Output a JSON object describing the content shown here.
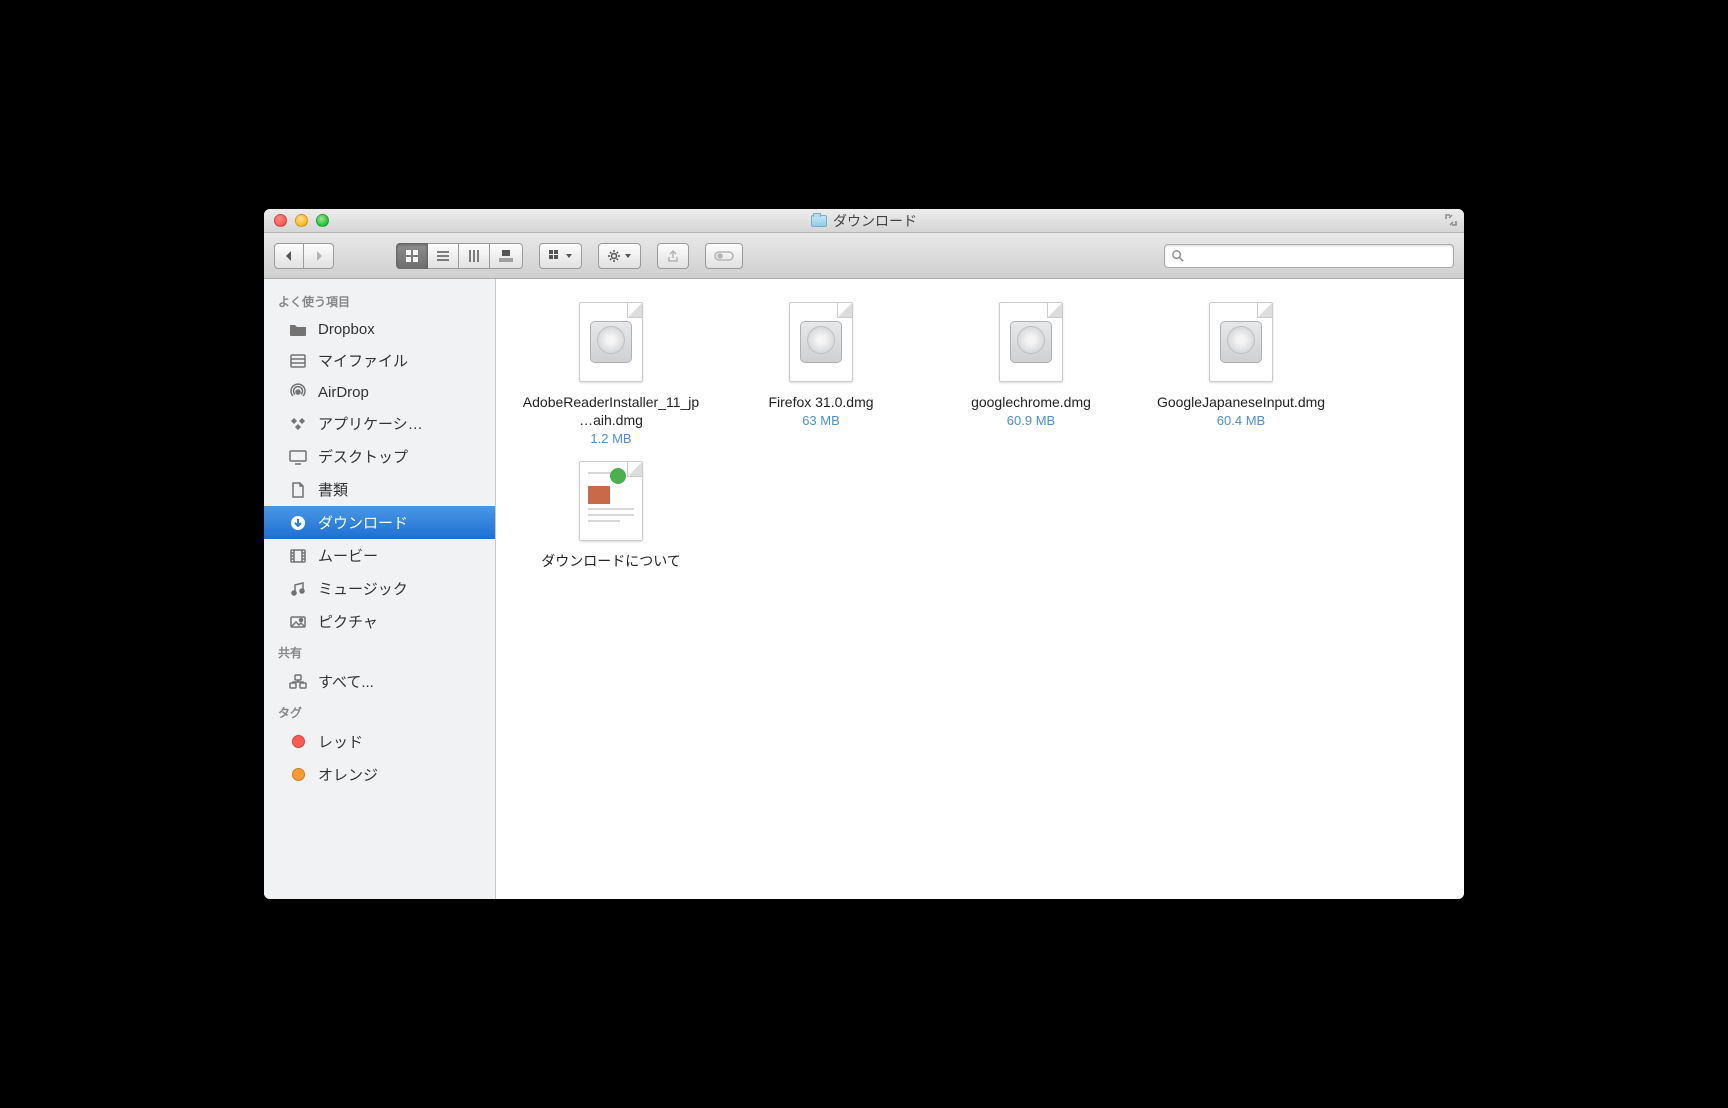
{
  "window": {
    "title": "ダウンロード"
  },
  "search": {
    "placeholder": ""
  },
  "sidebar": {
    "sections": {
      "favorites": {
        "label": "よく使う項目"
      },
      "shared": {
        "label": "共有"
      },
      "tags": {
        "label": "タグ"
      }
    },
    "favorites": [
      {
        "label": "Dropbox",
        "icon": "folder-icon"
      },
      {
        "label": "マイファイル",
        "icon": "all-my-files-icon"
      },
      {
        "label": "AirDrop",
        "icon": "airdrop-icon"
      },
      {
        "label": "アプリケーシ…",
        "icon": "applications-icon"
      },
      {
        "label": "デスクトップ",
        "icon": "desktop-icon"
      },
      {
        "label": "書類",
        "icon": "documents-icon"
      },
      {
        "label": "ダウンロード",
        "icon": "downloads-icon",
        "selected": true
      },
      {
        "label": "ムービー",
        "icon": "movies-icon"
      },
      {
        "label": "ミュージック",
        "icon": "music-icon"
      },
      {
        "label": "ピクチャ",
        "icon": "pictures-icon"
      }
    ],
    "shared": [
      {
        "label": "すべて...",
        "icon": "network-icon"
      }
    ],
    "tags": [
      {
        "label": "レッド",
        "color": "#ff5b52"
      },
      {
        "label": "オレンジ",
        "color": "#ff9a2e"
      }
    ]
  },
  "files": [
    {
      "name": "AdobeReaderInstaller_11_jp…aih.dmg",
      "size": "1.2 MB",
      "kind": "dmg"
    },
    {
      "name": "Firefox 31.0.dmg",
      "size": "63 MB",
      "kind": "dmg"
    },
    {
      "name": "googlechrome.dmg",
      "size": "60.9 MB",
      "kind": "dmg"
    },
    {
      "name": "GoogleJapaneseInput.dmg",
      "size": "60.4 MB",
      "kind": "dmg"
    },
    {
      "name": "ダウンロードについて",
      "size": "",
      "kind": "doc"
    }
  ]
}
